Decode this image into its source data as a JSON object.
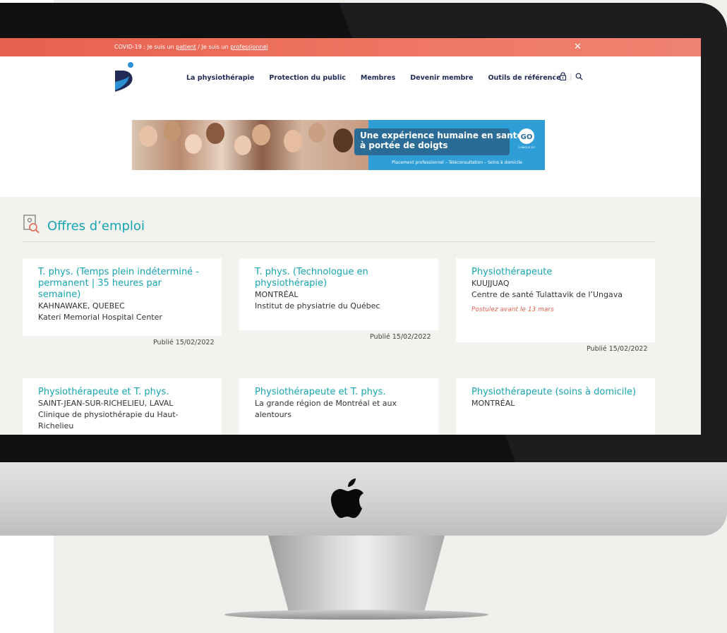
{
  "covid_bar": {
    "prefix": "COVID-19 : Je suis un ",
    "patient_link": "patient",
    "separator": " / Je suis un ",
    "pro_link": "professionnel",
    "close_glyph": "✕"
  },
  "nav": {
    "items": [
      "La physiothérapie",
      "Protection du public",
      "Membres",
      "Devenir membre",
      "Outils de référence"
    ],
    "icons": [
      "lock-icon",
      "search-icon"
    ]
  },
  "banner": {
    "line1": "Une expérience humaine en santé",
    "line2": "à portée de doigts",
    "subline": "Placement professionnel – Téléconsultation – Soins à domicile",
    "logo_text": "CLINIQUE GO"
  },
  "jobs": {
    "section_title": "Offres d’emploi",
    "cards": [
      {
        "title": "T. phys. (Temps plein indéterminé - permanent | 35 heures par semaine)",
        "location": "KAHNAWAKE, QUEBEC",
        "employer": "Kateri Memorial Hospital Center",
        "deadline": "",
        "published": "Publié 15/02/2022"
      },
      {
        "title": "T. phys. (Technologue en physiothérapie)",
        "location": "MONTRÉAL",
        "employer": "Institut de physiatrie du Québec",
        "deadline": "",
        "published": "Publié 15/02/2022"
      },
      {
        "title": "Physiothérapeute",
        "location": "KUUJJUAQ",
        "employer": "Centre de santé Tulattavik de l’Ungava",
        "deadline": "Postulez avant le 13 mars",
        "published": "Publié 15/02/2022"
      },
      {
        "title": "Physiothérapeute et T. phys.",
        "location": "SAINT-JEAN-SUR-RICHELIEU, LAVAL",
        "employer": "Clinique de physiothérapie du Haut-Richelieu",
        "deadline": "",
        "published": ""
      },
      {
        "title": "Physiothérapeute et T. phys.",
        "location": "La grande région de Montréal et aux alentours",
        "employer": "",
        "deadline": "",
        "published": ""
      },
      {
        "title": "Physiothérapeute (soins à domicile)",
        "location": "MONTRÉAL",
        "employer": "",
        "deadline": "",
        "published": ""
      }
    ]
  },
  "colors": {
    "accent": "#16a5b0",
    "covid_bar": "#ec6b58",
    "nav_text": "#1f2a55",
    "deadline": "#e8604f"
  }
}
